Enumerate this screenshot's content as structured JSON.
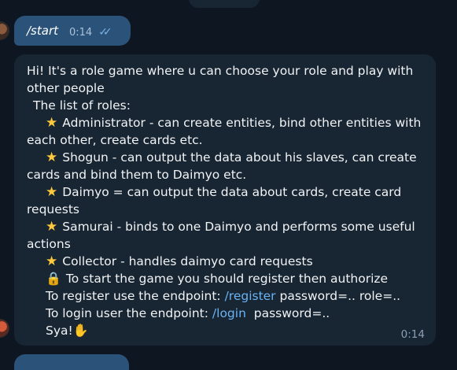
{
  "outgoing": {
    "text": "/start",
    "time": "0:14",
    "status_icon": "double-check-icon"
  },
  "incoming": {
    "lines": {
      "l1": "Hi! It's a role game where u can choose your role and play with",
      "l2": "other people",
      "l3": "The list of roles:",
      "admin": "Administrator - can create entities, bind other entities with",
      "admin_cont": "each other, create cards etc.",
      "shogun": "Shogun - can output the data about his slaves, can create",
      "shogun_cont": "cards and bind them to Daimyo etc.",
      "daimyo": "Daimyo = can output the data about cards, create card",
      "daimyo_cont": "requests",
      "samurai": "Samurai - binds to one Daimyo and performs some useful",
      "samurai_cont": "actions",
      "collector": "Collector - handles daimyo card requests",
      "start_game": "To start the game you should register then authorize",
      "register_prefix": "To register use the endpoint: ",
      "register_link": "/register",
      "register_suffix": " password=.. role=..",
      "login_prefix": "To login user the endpoint: ",
      "login_link": "/login",
      "login_suffix": "  password=..",
      "bye": "Sya!"
    },
    "time": "0:14",
    "icons": [
      "star-emoji",
      "lock-emoji",
      "waving-hand-emoji"
    ]
  },
  "colors": {
    "background": "#0e1621",
    "outgoing_bubble": "#2b5278",
    "incoming_bubble": "#182533",
    "link": "#6ab3f3"
  }
}
